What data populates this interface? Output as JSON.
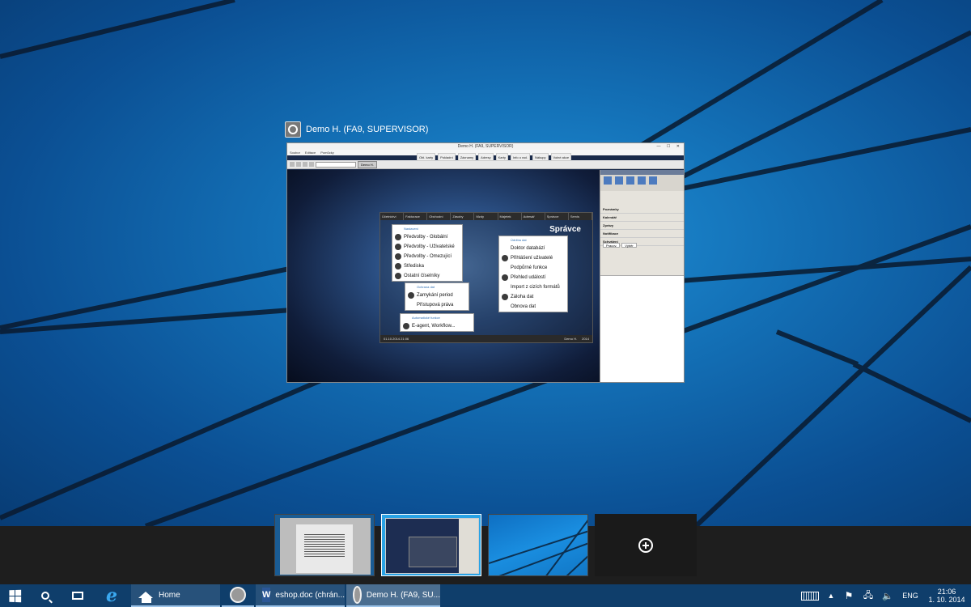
{
  "window": {
    "title": "Demo H. (FA9, SUPERVISOR)",
    "app_titlebar": "Demo H. (FA9, SUPERVISOR)",
    "menu": [
      "Soubor",
      "Editace",
      "Pomůcky"
    ],
    "toolbar_buttons": [
      "Obl. karty",
      "Pokladní",
      "Záznamy",
      "Adresy",
      "Karty",
      "Info o rad.",
      "Nákupy",
      "Volné akce"
    ],
    "demo_button": "Demo H.",
    "tabs": [
      "Účetnictví",
      "Fakturace",
      "Obchodní",
      "Zásoby",
      "Mzdy",
      "Majetek",
      "Adresář",
      "Správce",
      "Servis"
    ],
    "heading": "Správce",
    "menu_left": {
      "header": "Nastavení",
      "items": [
        "Předvolby - Globální",
        "Předvolby - Uživatelské",
        "Předvolby - Omezující",
        "Střediska",
        "Ostatní číselníky"
      ]
    },
    "menu_data_protection": {
      "header": "Ochrana dat",
      "items": [
        "Zamykání period",
        "Přístupová práva"
      ]
    },
    "menu_auto": {
      "header": "Automatické funkce",
      "items": [
        "E-agent, Workflow..."
      ]
    },
    "menu_right": {
      "header": "Údržba dat",
      "items": [
        "Doktor databází",
        "Přihlášení uživatelé",
        "Podpůrné funkce",
        "Přehled událostí",
        "Import z cizích formátů",
        "Záloha dat",
        "Obnova dat"
      ]
    },
    "status": [
      "01.10.2014 21:06",
      "Demo H.",
      "2014"
    ],
    "side_panel": {
      "items": [
        "Poznámky",
        "Kalendář",
        "Zprávy",
        "Notifikace",
        "Schválení"
      ],
      "tabs": [
        "Pracov.",
        "Výběr"
      ]
    }
  },
  "task_view": {
    "add_desktop_label": "+"
  },
  "taskbar": {
    "tasks": [
      {
        "label": "Home",
        "icon": "home-icon"
      },
      {
        "label": "",
        "icon": "fa-app-icon"
      },
      {
        "label": "eshop.doc (chrán...",
        "icon": "word-icon"
      },
      {
        "label": "Demo H. (FA9, SU...",
        "icon": "fa-app-icon"
      }
    ],
    "tray": {
      "language": "ENG",
      "time": "21:06",
      "date": "1. 10. 2014"
    }
  },
  "colors": {
    "taskbar": "#0f3e6b",
    "desktop": "#136fb5",
    "strip": "#1e1e1e"
  }
}
